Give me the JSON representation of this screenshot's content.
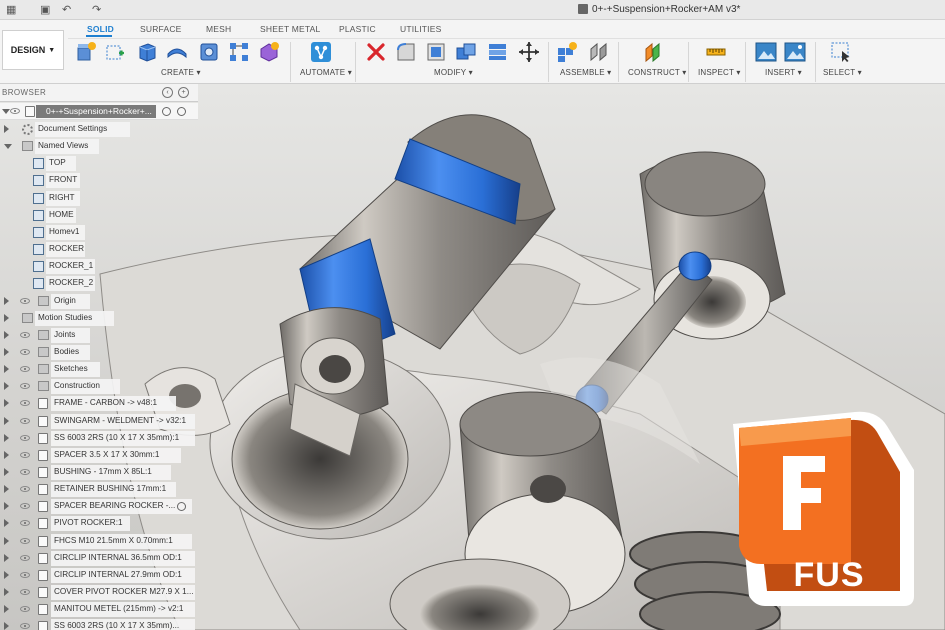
{
  "app": {
    "document_title": "0+-+Suspension+Rocker+AM v3*",
    "workspace_button": "DESIGN"
  },
  "tabs": [
    "SOLID",
    "SURFACE",
    "MESH",
    "SHEET METAL",
    "PLASTIC",
    "UTILITIES"
  ],
  "groups": {
    "create": "CREATE",
    "automate": "AUTOMATE",
    "modify": "MODIFY",
    "assemble": "ASSEMBLE",
    "construct": "CONSTRUCT",
    "inspect": "INSPECT",
    "insert": "INSERT",
    "select": "SELECT"
  },
  "browser": {
    "title": "BROWSER",
    "root": "0+-+Suspension+Rocker+...",
    "items": [
      {
        "label": "Document Settings",
        "icon": "gear-icon"
      },
      {
        "label": "Named Views",
        "icon": "folder-icon"
      },
      {
        "label": "TOP",
        "icon": "view-icon"
      },
      {
        "label": "FRONT",
        "icon": "view-icon"
      },
      {
        "label": "RIGHT",
        "icon": "view-icon"
      },
      {
        "label": "HOME",
        "icon": "view-icon"
      },
      {
        "label": "Homev1",
        "icon": "view-icon"
      },
      {
        "label": "ROCKER",
        "icon": "view-icon"
      },
      {
        "label": "ROCKER_1",
        "icon": "view-icon"
      },
      {
        "label": "ROCKER_2",
        "icon": "view-icon"
      },
      {
        "label": "Origin",
        "icon": "folder-icon"
      },
      {
        "label": "Motion Studies",
        "icon": "folder-icon"
      },
      {
        "label": "Joints",
        "icon": "folder-icon"
      },
      {
        "label": "Bodies",
        "icon": "folder-icon"
      },
      {
        "label": "Sketches",
        "icon": "folder-icon"
      },
      {
        "label": "Construction",
        "icon": "folder-icon"
      },
      {
        "label": "FRAME - CARBON -> v48:1",
        "icon": "component-icon"
      },
      {
        "label": "SWINGARM - WELDMENT -> v32:1",
        "icon": "component-icon"
      },
      {
        "label": "SS 6003 2RS (10 X 17 X 35mm):1",
        "icon": "component-icon"
      },
      {
        "label": "SPACER 3.5 X 17 X 30mm:1",
        "icon": "component-icon"
      },
      {
        "label": "BUSHING - 17mm X 85L:1",
        "icon": "component-icon"
      },
      {
        "label": "RETAINER BUSHING 17mm:1",
        "icon": "component-icon"
      },
      {
        "label": "SPACER BEARING ROCKER -...",
        "icon": "component-icon"
      },
      {
        "label": "PIVOT ROCKER:1",
        "icon": "component-icon"
      },
      {
        "label": "FHCS M10 21.5mm X 0.70mm:1",
        "icon": "component-icon"
      },
      {
        "label": "CIRCLIP INTERNAL 36.5mm OD:1",
        "icon": "component-icon"
      },
      {
        "label": "CIRCLIP INTERNAL 27.9mm OD:1",
        "icon": "component-icon"
      },
      {
        "label": "COVER PIVOT ROCKER M27.9 X 1...",
        "icon": "component-icon"
      },
      {
        "label": "MANITOU METEL (215mm) -> v2:1",
        "icon": "component-icon"
      },
      {
        "label": "SS 6003 2RS (10 X 17 X 35mm)...",
        "icon": "component-icon"
      }
    ]
  },
  "logo": {
    "letter": "F",
    "text": "FUS"
  },
  "colors": {
    "accent": "#1e7fd0",
    "logo_orange": "#f37021",
    "logo_dark": "#c24e12",
    "bushing_blue": "#2a6fd6"
  }
}
